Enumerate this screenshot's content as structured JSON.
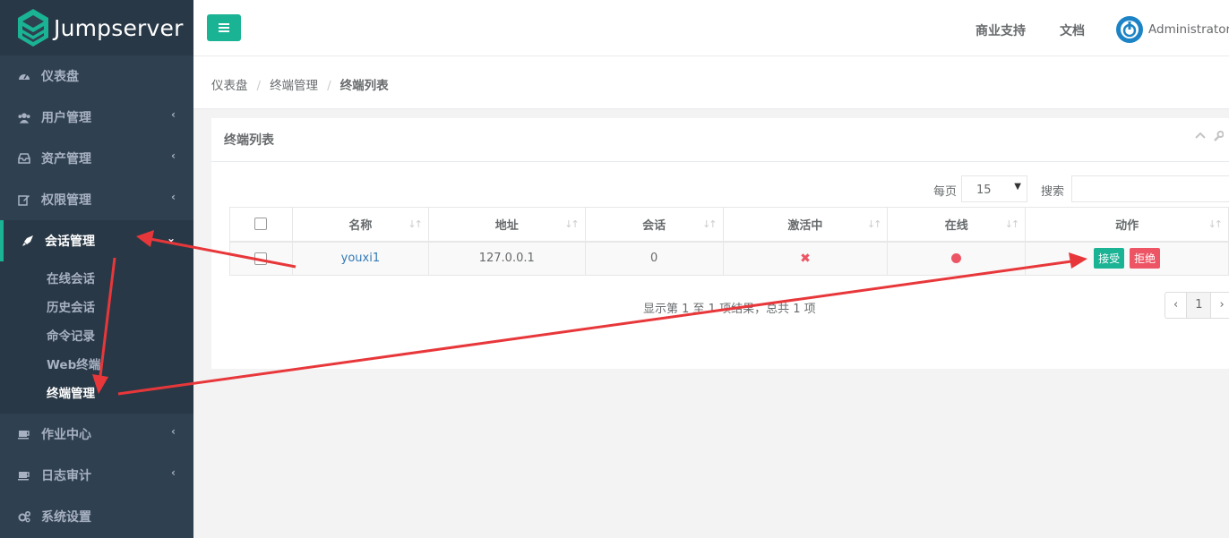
{
  "brand": {
    "name": "Jumpserver"
  },
  "topbar": {
    "support": "商业支持",
    "docs": "文档",
    "user": "Administrator"
  },
  "sidebar": {
    "items": [
      {
        "label": "仪表盘",
        "icon": "dashboard-icon"
      },
      {
        "label": "用户管理",
        "icon": "users-icon"
      },
      {
        "label": "资产管理",
        "icon": "inbox-icon"
      },
      {
        "label": "权限管理",
        "icon": "edit-icon"
      },
      {
        "label": "会话管理",
        "icon": "rocket-icon"
      },
      {
        "label": "作业中心",
        "icon": "coffee-icon"
      },
      {
        "label": "日志审计",
        "icon": "coffee-icon"
      },
      {
        "label": "系统设置",
        "icon": "gears-icon"
      }
    ],
    "submenu": [
      "在线会话",
      "历史会话",
      "命令记录",
      "Web终端",
      "终端管理"
    ]
  },
  "breadcrumb": {
    "home": "仪表盘",
    "section": "终端管理",
    "current": "终端列表"
  },
  "panel": {
    "title": "终端列表"
  },
  "controls": {
    "perpage_label": "每页",
    "perpage_value": "15",
    "search_label": "搜索"
  },
  "table": {
    "headers": [
      "名称",
      "地址",
      "会话",
      "激活中",
      "在线",
      "动作"
    ],
    "rows": [
      {
        "name": "youxi1",
        "address": "127.0.0.1",
        "sessions": "0",
        "active": "✖",
        "accept": "接受",
        "reject": "拒绝"
      }
    ]
  },
  "footer": {
    "info": "显示第 1 至 1 项结果，总共 1 项",
    "prev": "‹",
    "page": "1",
    "next": "›"
  },
  "colors": {
    "accent": "#1ab394",
    "danger": "#ed5565",
    "sidebar": "#2f4050",
    "annotation": "#e8373a"
  }
}
